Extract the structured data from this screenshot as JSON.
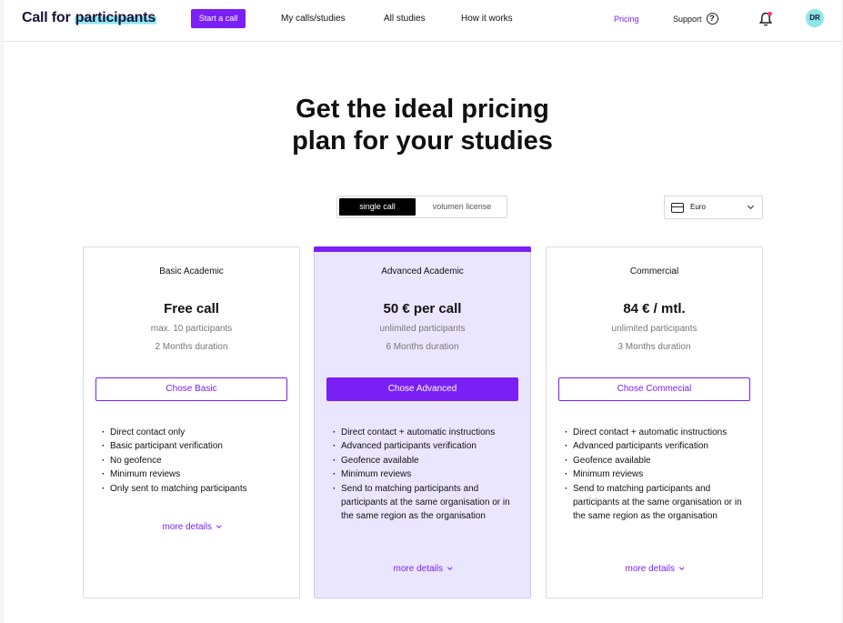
{
  "nav": {
    "logo_prefix": "Call for ",
    "logo_highlight": "participants",
    "start_call": "Start a call",
    "links": [
      "My calls/studies",
      "All studies",
      "How it works"
    ],
    "pricing": "Pricing",
    "support": "Support",
    "avatar_initials": "DR",
    "accent_color": "#7a1ff5"
  },
  "hero": {
    "title_line1": "Get the ideal pricing",
    "title_line2": "plan for your studies"
  },
  "license_toggle": {
    "options": [
      "single call",
      "volumen license"
    ],
    "selected": "single call"
  },
  "currency": {
    "value": "Euro"
  },
  "plans": [
    {
      "name": "Basic Academic",
      "price": "Free call",
      "participants": "max. 10 participants",
      "duration": "2 Months duration",
      "cta": "Chose Basic",
      "featured": false,
      "features": [
        "Direct contact only",
        "Basic participant verification",
        "No geofence",
        "Minimum reviews",
        "Only sent to matching participants"
      ],
      "more": "more details"
    },
    {
      "name": "Advanced Academic",
      "price": "50 € per call",
      "participants": "unlimited participants",
      "duration": "6 Months duration",
      "cta": "Chose Advanced",
      "featured": true,
      "features": [
        "Direct contact + automatic instructions",
        "Advanced participants verification",
        "Geofence available",
        "Minimum reviews",
        "Send to matching participants and participants at the same organisation or in the same region as the organisation"
      ],
      "more": "more details"
    },
    {
      "name": "Commercial",
      "price": "84 € / mtl.",
      "participants": "unlimited participants",
      "duration": "3 Months duration",
      "cta": "Chose Commecial",
      "featured": false,
      "features": [
        "Direct contact + automatic instructions",
        "Advanced participants verification",
        "Geofence available",
        "Minimum reviews",
        "Send to matching participants and participants at the same organisation or in the same region as the organisation"
      ],
      "more": "more details"
    }
  ]
}
